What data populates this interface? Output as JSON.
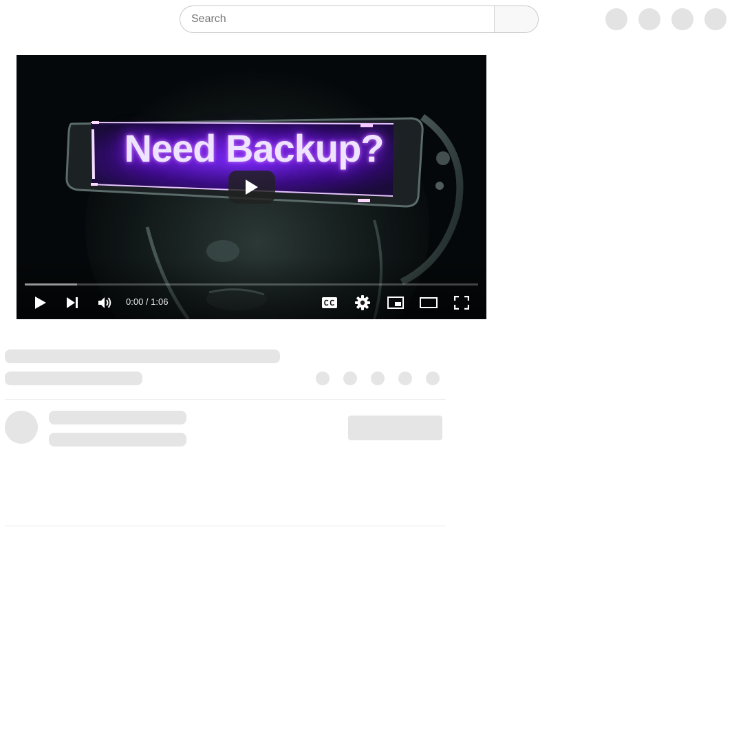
{
  "header": {
    "search": {
      "placeholder": "Search",
      "value": ""
    }
  },
  "player": {
    "thumbnail_text": "Need Backup?",
    "current_time": "0:00",
    "duration": "1:06",
    "time_separator": " / ",
    "progress_fraction": 0,
    "buffered_fraction": 0.115,
    "icons": {
      "big_play": "play-icon",
      "play": "play-icon",
      "next": "next-track-icon",
      "volume": "volume-icon",
      "captions": "closed-captions-icon",
      "settings": "gear-icon",
      "miniplayer": "miniplayer-icon",
      "theater": "theater-mode-icon",
      "fullscreen": "fullscreen-icon"
    }
  },
  "colors": {
    "skeleton": "#e5e5e5",
    "neon_glow": "#8a2be2",
    "player_bg": "#05080a"
  }
}
